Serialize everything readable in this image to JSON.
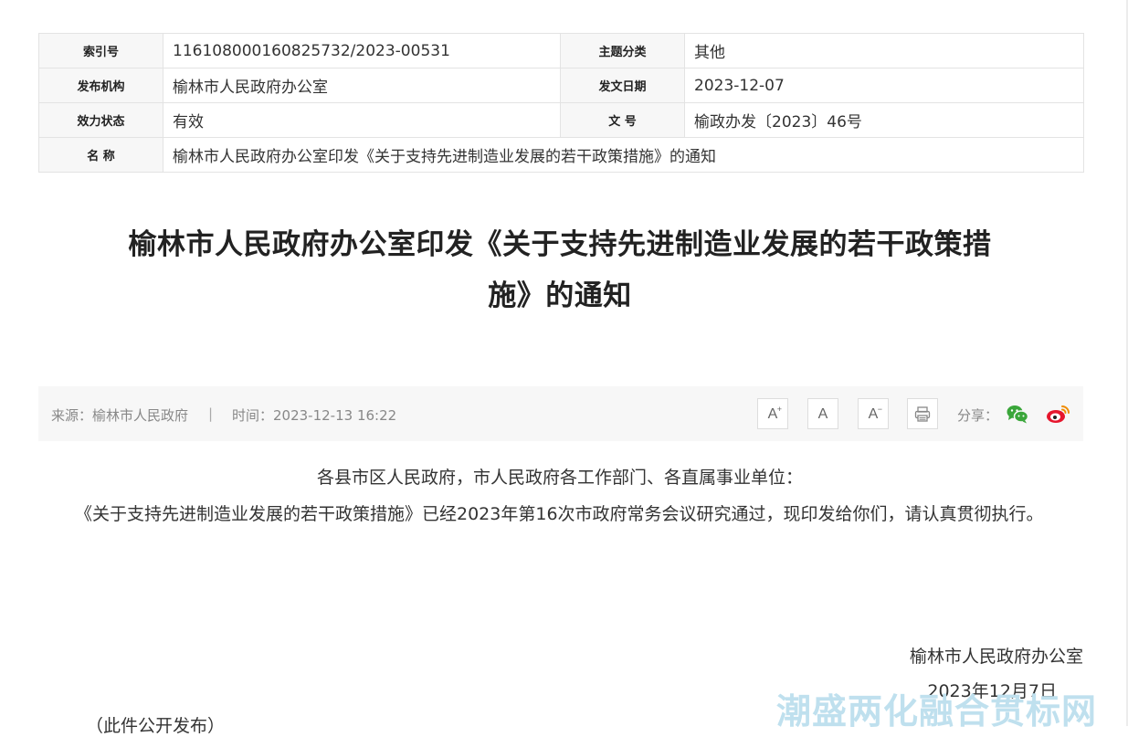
{
  "info_table": {
    "rows": [
      {
        "label1": "索引号",
        "value1": "116108000160825732/2023-00531",
        "label2": "主题分类",
        "value2": "其他"
      },
      {
        "label1": "发布机构",
        "value1": "榆林市人民政府办公室",
        "label2": "发文日期",
        "value2": "2023-12-07"
      },
      {
        "label1": "效力状态",
        "value1": "有效",
        "label2": "文 号",
        "value2": "榆政办发〔2023〕46号"
      }
    ],
    "name_label": "名 称",
    "name_value": "榆林市人民政府办公室印发《关于支持先进制造业发展的若干政策措施》的通知"
  },
  "title": {
    "line1": "榆林市人民政府办公室印发《关于支持先进制造业发展的若干政策措",
    "line2": "施》的通知"
  },
  "meta": {
    "source": "来源：榆林市人民政府",
    "separator": "|",
    "time": "时间：2023-12-13 16:22",
    "font_increase": "A",
    "font_increase_mark": "+",
    "font_normal": "A",
    "font_decrease": "A",
    "font_decrease_mark": "−",
    "share_label": "分享："
  },
  "body": {
    "salutation": "各县市区人民政府，市人民政府各工作部门、各直属事业单位：",
    "paragraph": "《关于支持先进制造业发展的若干政策措施》已经2023年第16次市政府常务会议研究通过，现印发给你们，请认真贯彻执行。",
    "signature_org": "榆林市人民政府办公室",
    "signature_date": "2023年12月7日",
    "public_note": "（此件公开发布）"
  },
  "watermark": "潮盛两化融合贯标网",
  "colors": {
    "wechat": "#3aa63a",
    "weibo": "#e6162d",
    "watermark": "#bfe0ee"
  }
}
